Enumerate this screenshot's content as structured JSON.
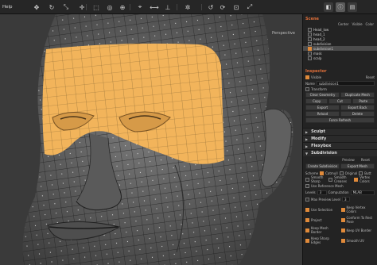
{
  "menu": [
    "Help"
  ],
  "viewport": {
    "label": "Perspective"
  },
  "scene": {
    "title": "Scene",
    "columns": [
      "Center",
      "Visible",
      "Color"
    ],
    "items": [
      {
        "label": "Head_low",
        "selected": false
      },
      {
        "label": "head_1",
        "selected": false
      },
      {
        "label": "head_2",
        "selected": false
      },
      {
        "label": "subdivision",
        "selected": false
      },
      {
        "label": "subdivision1",
        "selected": true
      },
      {
        "label": "mask",
        "selected": false
      },
      {
        "label": "scalp",
        "selected": false
      }
    ]
  },
  "inspector": {
    "title": "Inspector",
    "visible_label": "Visible",
    "reset_label": "Reset",
    "name_label": "Name",
    "name_value": "subdivision1",
    "transform_label": "Transform",
    "buttons": [
      [
        "Clear Geometry",
        "Duplicate Mesh"
      ],
      [
        "Copy",
        "Cut",
        "Paste"
      ],
      [
        "Export",
        "Export Back"
      ],
      [
        "Reload",
        "Delete"
      ],
      [
        "Force Refresh"
      ]
    ]
  },
  "sections": [
    "Sculpt",
    "Modify",
    "Flexybox",
    "Subdivision"
  ],
  "subdivision": {
    "preview_label": "Preview",
    "reset_label": "Reset",
    "create_label": "Create Subdivision",
    "export_label": "Export Mesh",
    "scheme_label": "Scheme",
    "schemes": [
      "Catmull",
      "Original",
      "Butt"
    ],
    "opt1": "Smooth Sharp",
    "opt2": "Smooth Creases",
    "opt3": "Vertex Colors",
    "opt4": "Use Reference Mesh",
    "levels_label": "Levels",
    "levels_value": "3",
    "comp_label": "Computation",
    "comp_value": "MLAB",
    "maxlevel_label": "Max Preview Level",
    "maxlevel_value": "3",
    "checks": [
      {
        "label": "Use Selection",
        "on": true
      },
      {
        "label": "Keep Vertex Colors",
        "on": true
      },
      {
        "label": "Project",
        "on": true
      },
      {
        "label": "Conform To Rest Pose",
        "on": true
      },
      {
        "label": "Keep Mesh Border",
        "on": true
      },
      {
        "label": "Keep UV Border",
        "on": true
      },
      {
        "label": "Keep Sharp Edges",
        "on": true
      },
      {
        "label": "Smooth UV",
        "on": true
      }
    ]
  },
  "colors": {
    "accent": "#e08a3a",
    "mask": "#f2b45b",
    "panel": "#232323"
  }
}
